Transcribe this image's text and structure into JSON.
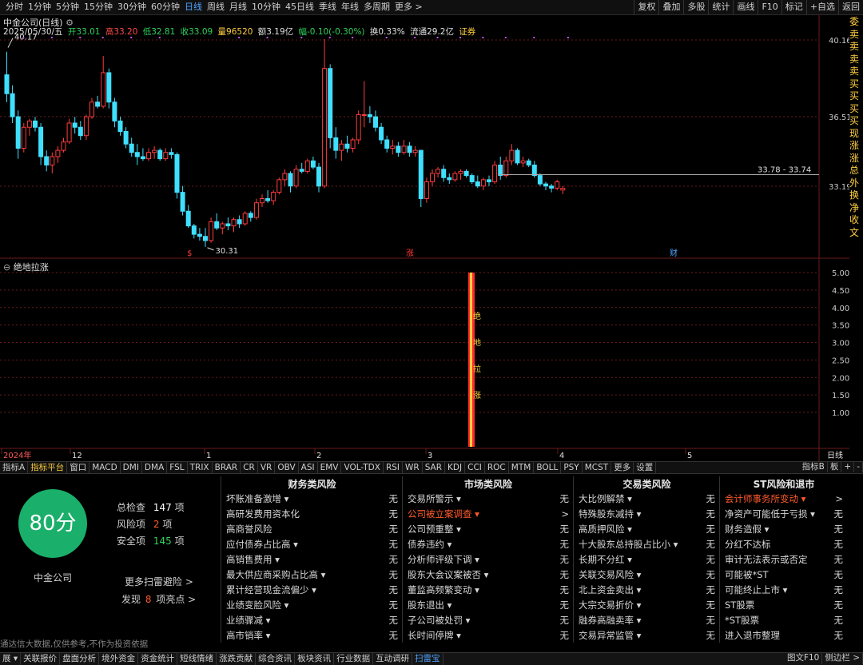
{
  "toolbar": {
    "periods": [
      "分时",
      "1分钟",
      "5分钟",
      "15分钟",
      "30分钟",
      "60分钟",
      "日线",
      "周线",
      "月线",
      "10分钟",
      "45日线",
      "季线",
      "年线",
      "多周期",
      "更多 >"
    ],
    "active_period": "日线",
    "right_tools": [
      "复权",
      "叠加",
      "多股",
      "统计",
      "画线",
      "F10",
      "标记",
      "+自选",
      "返回"
    ]
  },
  "chart": {
    "title": "中金公司(日线)",
    "date": "2025/05/30/五",
    "open_label": "开",
    "open": "33.01",
    "high_label": "高",
    "high": "33.20",
    "low_label": "低",
    "low": "32.81",
    "close_label": "收",
    "close": "33.09",
    "volume_label": "量",
    "volume": "96520",
    "amount_label": "额",
    "amount": "3.19亿",
    "change_label": "幅",
    "change": "-0.10(-0.30%)",
    "turnover_label": "换",
    "turnover": "0.33%",
    "float_label": "流通",
    "float": "29.2亿",
    "tag": "证券",
    "price_axis": [
      "40.16",
      "36.51",
      "33.19"
    ],
    "high_marker": "40.17",
    "low_marker": "30.31",
    "range_label": "33.78 - 33.74",
    "event_marks": [
      "$",
      "涨",
      "财"
    ],
    "right_edge_chars": [
      "委",
      "卖",
      "卖",
      "卖",
      "卖",
      "买",
      "买",
      "买",
      "买",
      "现",
      "涨",
      "涨",
      "总",
      "外",
      "换",
      "净",
      "收",
      "文"
    ]
  },
  "chart_data": {
    "type": "candlestick",
    "x_labels": [
      "2024年",
      "12",
      "1",
      "2",
      "3",
      "4",
      "5",
      "日线"
    ],
    "y_ticks": [
      "40.16",
      "36.51",
      "33.19"
    ],
    "ohlc": [
      [
        38.5,
        39.6,
        37.2,
        37.6
      ],
      [
        37.6,
        38.0,
        36.2,
        36.5
      ],
      [
        36.5,
        36.8,
        34.5,
        35.0
      ],
      [
        35.0,
        36.2,
        34.8,
        36.0
      ],
      [
        36.0,
        36.4,
        35.6,
        36.3
      ],
      [
        36.3,
        36.5,
        35.8,
        36.0
      ],
      [
        36.0,
        36.2,
        34.2,
        34.6
      ],
      [
        34.6,
        34.9,
        33.9,
        34.2
      ],
      [
        34.2,
        34.8,
        33.8,
        34.6
      ],
      [
        34.6,
        35.1,
        34.3,
        34.9
      ],
      [
        34.9,
        35.5,
        34.8,
        35.3
      ],
      [
        35.3,
        36.4,
        35.2,
        36.2
      ],
      [
        36.2,
        36.5,
        35.7,
        36.0
      ],
      [
        36.0,
        36.3,
        35.4,
        35.6
      ],
      [
        35.6,
        36.6,
        35.4,
        36.5
      ],
      [
        36.5,
        37.4,
        36.4,
        37.2
      ],
      [
        37.2,
        37.5,
        36.9,
        37.0
      ],
      [
        37.0,
        39.4,
        36.9,
        38.6
      ],
      [
        38.6,
        38.8,
        36.9,
        37.2
      ],
      [
        37.2,
        37.4,
        36.0,
        36.3
      ],
      [
        36.3,
        36.5,
        35.6,
        35.8
      ],
      [
        35.8,
        36.0,
        35.0,
        35.2
      ],
      [
        35.2,
        35.5,
        34.6,
        34.8
      ],
      [
        34.8,
        35.2,
        34.2,
        34.6
      ],
      [
        34.6,
        35.0,
        34.4,
        34.5
      ],
      [
        34.5,
        35.0,
        34.4,
        34.8
      ],
      [
        34.8,
        35.1,
        34.5,
        34.9
      ],
      [
        34.9,
        35.0,
        34.4,
        34.5
      ],
      [
        34.5,
        35.0,
        34.4,
        34.8
      ],
      [
        34.8,
        35.0,
        34.5,
        34.7
      ],
      [
        34.7,
        34.8,
        32.6,
        32.9
      ],
      [
        32.9,
        33.2,
        31.8,
        32.0
      ],
      [
        32.0,
        32.3,
        31.2,
        31.3
      ],
      [
        31.3,
        31.4,
        30.7,
        30.9
      ],
      [
        30.9,
        31.2,
        30.6,
        30.8
      ],
      [
        30.8,
        31.2,
        30.3,
        30.6
      ],
      [
        30.6,
        31.7,
        30.5,
        31.5
      ],
      [
        31.5,
        31.9,
        31.1,
        31.2
      ],
      [
        31.2,
        31.5,
        30.9,
        31.4
      ],
      [
        31.4,
        31.7,
        31.1,
        31.3
      ],
      [
        31.3,
        31.7,
        31.0,
        31.6
      ],
      [
        31.6,
        31.8,
        31.2,
        31.4
      ],
      [
        31.4,
        32.0,
        31.3,
        31.9
      ],
      [
        31.9,
        32.0,
        31.5,
        31.7
      ],
      [
        31.7,
        32.6,
        31.6,
        32.4
      ],
      [
        32.4,
        32.8,
        32.2,
        32.6
      ],
      [
        32.6,
        33.0,
        32.4,
        32.5
      ],
      [
        32.5,
        33.0,
        32.3,
        32.9
      ],
      [
        32.9,
        33.6,
        32.8,
        33.5
      ],
      [
        33.5,
        34.0,
        33.2,
        33.8
      ],
      [
        33.8,
        33.9,
        32.9,
        33.2
      ],
      [
        33.2,
        34.2,
        33.1,
        34.0
      ],
      [
        34.0,
        34.3,
        33.8,
        33.9
      ],
      [
        33.9,
        34.5,
        33.8,
        34.4
      ],
      [
        34.4,
        34.6,
        34.0,
        34.1
      ],
      [
        34.1,
        34.3,
        32.9,
        33.2
      ],
      [
        33.2,
        40.2,
        33.1,
        38.8
      ],
      [
        38.8,
        39.0,
        35.0,
        35.5
      ],
      [
        35.5,
        36.0,
        34.5,
        34.9
      ],
      [
        34.9,
        35.4,
        34.4,
        35.2
      ],
      [
        35.2,
        35.6,
        34.8,
        35.0
      ],
      [
        35.0,
        35.5,
        34.8,
        35.4
      ],
      [
        35.4,
        36.8,
        35.2,
        36.6
      ],
      [
        36.6,
        38.2,
        36.0,
        36.6
      ],
      [
        36.6,
        37.0,
        36.2,
        36.5
      ],
      [
        36.5,
        36.8,
        35.8,
        36.0
      ],
      [
        36.0,
        36.2,
        35.2,
        35.4
      ],
      [
        35.4,
        35.6,
        34.8,
        35.0
      ],
      [
        35.0,
        35.4,
        34.7,
        35.1
      ],
      [
        35.1,
        35.3,
        34.6,
        34.8
      ],
      [
        34.8,
        35.4,
        34.7,
        35.1
      ],
      [
        35.1,
        35.3,
        34.6,
        34.8
      ],
      [
        34.8,
        35.1,
        34.6,
        34.9
      ],
      [
        34.9,
        34.9,
        32.2,
        32.6
      ],
      [
        32.6,
        33.6,
        32.4,
        33.4
      ],
      [
        33.4,
        34.0,
        33.2,
        33.8
      ],
      [
        33.8,
        34.1,
        33.6,
        34.0
      ],
      [
        34.0,
        34.2,
        33.4,
        33.6
      ],
      [
        33.6,
        33.8,
        33.3,
        33.5
      ],
      [
        33.5,
        33.9,
        33.4,
        33.8
      ],
      [
        33.8,
        34.0,
        33.5,
        33.9
      ],
      [
        33.9,
        34.0,
        33.6,
        33.7
      ],
      [
        33.7,
        33.8,
        33.3,
        33.4
      ],
      [
        33.4,
        33.7,
        33.1,
        33.2
      ],
      [
        33.2,
        33.6,
        33.0,
        33.5
      ],
      [
        33.5,
        33.7,
        33.2,
        33.4
      ],
      [
        33.4,
        34.4,
        33.3,
        34.2
      ],
      [
        34.2,
        34.6,
        33.5,
        33.7
      ],
      [
        33.7,
        34.6,
        33.6,
        34.4
      ],
      [
        34.4,
        35.2,
        34.2,
        34.9
      ],
      [
        34.9,
        35.0,
        34.2,
        34.3
      ],
      [
        34.3,
        34.6,
        34.1,
        34.4
      ],
      [
        34.4,
        34.5,
        34.1,
        34.2
      ],
      [
        34.2,
        34.4,
        33.6,
        33.7
      ],
      [
        33.7,
        33.8,
        33.2,
        33.3
      ],
      [
        33.3,
        33.4,
        33.0,
        33.2
      ],
      [
        33.2,
        33.3,
        32.9,
        33.1
      ],
      [
        33.1,
        33.5,
        33.0,
        33.4
      ],
      [
        33.01,
        33.2,
        32.81,
        33.09
      ]
    ],
    "indicator": {
      "name": "绝地拉涨",
      "y_ticks": [
        "5.00",
        "4.50",
        "4.00",
        "3.50",
        "3.00",
        "2.50",
        "2.00",
        "1.50",
        "1.00"
      ],
      "signal_value": 5.0,
      "signal_index": 56,
      "signal_text": "绝地拉涨"
    }
  },
  "indicators_bar": {
    "tabs": [
      "指标A",
      "指标平台",
      "窗口",
      "MACD",
      "DMI",
      "DMA",
      "FSL",
      "TRIX",
      "BRAR",
      "CR",
      "VR",
      "OBV",
      "ASI",
      "EMV",
      "VOL-TDX",
      "RSI",
      "WR",
      "SAR",
      "KDJ",
      "CCI",
      "ROC",
      "MTM",
      "BOLL",
      "PSY",
      "MCST",
      "更多",
      "设置"
    ],
    "active": "指标平台",
    "right": [
      "指标B",
      "板",
      "+",
      "-"
    ]
  },
  "risk": {
    "score": "80分",
    "company": "中金公司",
    "total_label": "总检查",
    "total": "147",
    "total_unit": "项",
    "risk_label": "风险项",
    "risk": "2",
    "risk_unit": "项",
    "safe_label": "安全项",
    "safe": "145",
    "safe_unit": "项",
    "more_link": "更多扫雷避险 >",
    "highlight_prefix": "发现",
    "highlight_count": "8",
    "highlight_suffix": "项亮点 >",
    "columns": [
      {
        "title": "财务类风险",
        "rows": [
          {
            "label": "坏账准备激增 ▾",
            "value": "无"
          },
          {
            "label": "高研发费用资本化",
            "value": "无"
          },
          {
            "label": "高商誉风险",
            "value": "无"
          },
          {
            "label": "应付债券占比高 ▾",
            "value": "无"
          },
          {
            "label": "高销售费用 ▾",
            "value": "无"
          },
          {
            "label": "最大供应商采购占比高 ▾",
            "value": "无"
          },
          {
            "label": "累计经营现金流偏少 ▾",
            "value": "无"
          },
          {
            "label": "业绩变脸风险 ▾",
            "value": "无"
          },
          {
            "label": "业绩骤减 ▾",
            "value": "无"
          },
          {
            "label": "高市销率 ▾",
            "value": "无"
          }
        ]
      },
      {
        "title": "市场类风险",
        "rows": [
          {
            "label": "交易所警示 ▾",
            "value": "无"
          },
          {
            "label": "公司被立案调查 ▾",
            "value": ">",
            "alert": true
          },
          {
            "label": "公司预重整 ▾",
            "value": "无"
          },
          {
            "label": "债券违约 ▾",
            "value": "无"
          },
          {
            "label": "分析师评级下调 ▾",
            "value": "无"
          },
          {
            "label": "股东大会议案被否 ▾",
            "value": "无"
          },
          {
            "label": "董监高频繁变动 ▾",
            "value": "无"
          },
          {
            "label": "股东退出 ▾",
            "value": "无"
          },
          {
            "label": "子公司被处罚 ▾",
            "value": "无"
          },
          {
            "label": "长时间停牌 ▾",
            "value": "无"
          }
        ]
      },
      {
        "title": "交易类风险",
        "rows": [
          {
            "label": "大比例解禁 ▾",
            "value": "无"
          },
          {
            "label": "特殊股东减持 ▾",
            "value": "无"
          },
          {
            "label": "高质押风险 ▾",
            "value": "无"
          },
          {
            "label": "十大股东总持股占比小 ▾",
            "value": "无"
          },
          {
            "label": "长期不分红 ▾",
            "value": "无"
          },
          {
            "label": "关联交易风险 ▾",
            "value": "无"
          },
          {
            "label": "北上资金卖出 ▾",
            "value": "无"
          },
          {
            "label": "大宗交易折价 ▾",
            "value": "无"
          },
          {
            "label": "融券高融卖率 ▾",
            "value": "无"
          },
          {
            "label": "交易异常监管 ▾",
            "value": "无"
          }
        ]
      },
      {
        "title": "ST风险和退市",
        "rows": [
          {
            "label": "会计师事务所变动 ▾",
            "value": ">",
            "alert": true
          },
          {
            "label": "净资产可能低于亏损 ▾",
            "value": "无"
          },
          {
            "label": "财务造假 ▾",
            "value": "无"
          },
          {
            "label": "分红不达标",
            "value": "无"
          },
          {
            "label": "审计无法表示或否定",
            "value": "无"
          },
          {
            "label": "可能被*ST",
            "value": "无"
          },
          {
            "label": "可能终止上市 ▾",
            "value": "无"
          },
          {
            "label": "ST股票",
            "value": "无"
          },
          {
            "label": "*ST股票",
            "value": "无"
          },
          {
            "label": "进入退市整理",
            "value": "无"
          }
        ]
      }
    ]
  },
  "footer": {
    "disclaimer": "通达信大数据,仅供参考,不作为投资依据",
    "tabs": [
      "展 ▾",
      "关联报价",
      "盘面分析",
      "境外资金",
      "资金统计",
      "短线情绪",
      "涨跌贡献",
      "综合资讯",
      "板块资讯",
      "行业数据",
      "互动调研",
      "扫雷宝"
    ],
    "active": "扫雷宝",
    "right": [
      "图文F10",
      "侧边栏 >"
    ]
  },
  "colors": {
    "up": "#ff3b3b",
    "down": "#3fe0ff",
    "grid": "#6b1a1a",
    "accent": "#4fa3ff",
    "score": "#1aaf6a"
  }
}
